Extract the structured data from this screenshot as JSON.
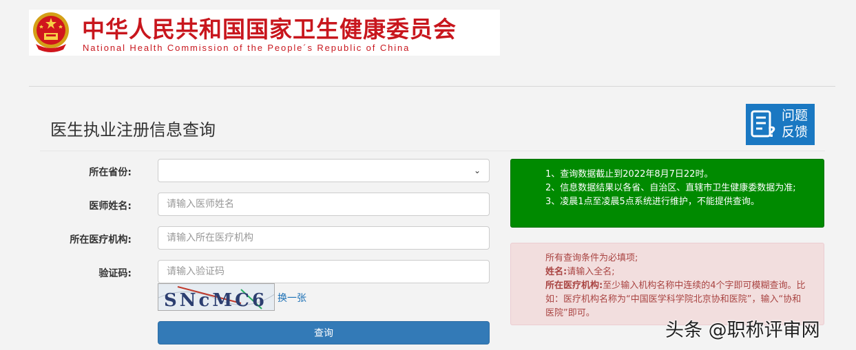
{
  "header": {
    "org_name_cn": "中华人民共和国国家卫生健康委员会",
    "org_name_en": "National Health Commission of the People´s Republic of China"
  },
  "page": {
    "title": "医生执业注册信息查询"
  },
  "feedback": {
    "line1": "问题",
    "line2": "反馈",
    "icon": "feedback-icon"
  },
  "form": {
    "province_label": "所在省份:",
    "province_value": "",
    "name_label": "医师姓名:",
    "name_placeholder": "请输入医师姓名",
    "institution_label": "所在医疗机构:",
    "institution_placeholder": "请输入所在医疗机构",
    "captcha_label": "验证码:",
    "captcha_placeholder": "请输入验证码",
    "captcha_text": "SNcMC6",
    "swap_label": "换一张",
    "submit_label": "查询"
  },
  "notice_green": {
    "line1": "1、查询数据截止到2022年8月7日22时。",
    "line2": "2、信息数据结果以各省、自治区、直辖市卫生健康委数据为准;",
    "line3": "3、凌晨1点至凌晨5点系统进行维护，不能提供查询。"
  },
  "notice_red": {
    "line1": "所有查询条件为必填项;",
    "name_key": "姓名:",
    "name_text": "请输入全名;",
    "inst_key": "所在医疗机构:",
    "inst_text": "至少输入机构名称中连续的4个字即可模糊查询。比如：医疗机构名称为“中国医学科学院北京协和医院”，输入“协和医院”即可。"
  },
  "watermark": "头条 @职称评审网",
  "colors": {
    "brand_red": "#c8161d",
    "primary_blue": "#337ab7",
    "notice_green": "#008a00",
    "notice_red_bg": "#f2dede"
  }
}
